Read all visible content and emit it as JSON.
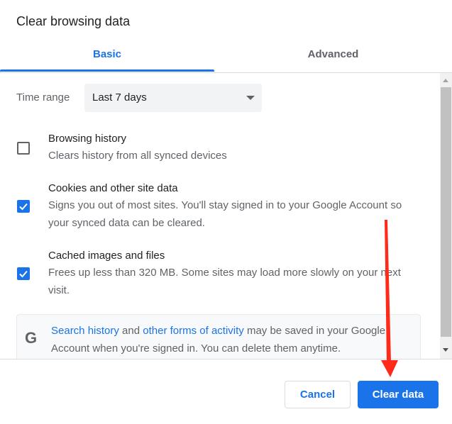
{
  "dialog": {
    "title": "Clear browsing data"
  },
  "tabs": [
    {
      "label": "Basic",
      "active": true
    },
    {
      "label": "Advanced",
      "active": false
    }
  ],
  "time_range": {
    "label": "Time range",
    "selected": "Last 7 days"
  },
  "items": [
    {
      "title": "Browsing history",
      "description": "Clears history from all synced devices",
      "checked": false
    },
    {
      "title": "Cookies and other site data",
      "description": "Signs you out of most sites. You'll stay signed in to your Google Account so your synced data can be cleared.",
      "checked": true
    },
    {
      "title": "Cached images and files",
      "description": "Frees up less than 320 MB. Some sites may load more slowly on your next visit.",
      "checked": true
    }
  ],
  "google_notice": {
    "icon": "G",
    "link1": "Search history",
    "and": " and ",
    "link2": "other forms of activity",
    "rest": " may be saved in your Google Account when you're signed in. You can delete them anytime."
  },
  "buttons": {
    "cancel": "Cancel",
    "clear": "Clear data"
  },
  "colors": {
    "accent": "#1a73e8",
    "annotation_arrow": "#ff2a1a"
  }
}
